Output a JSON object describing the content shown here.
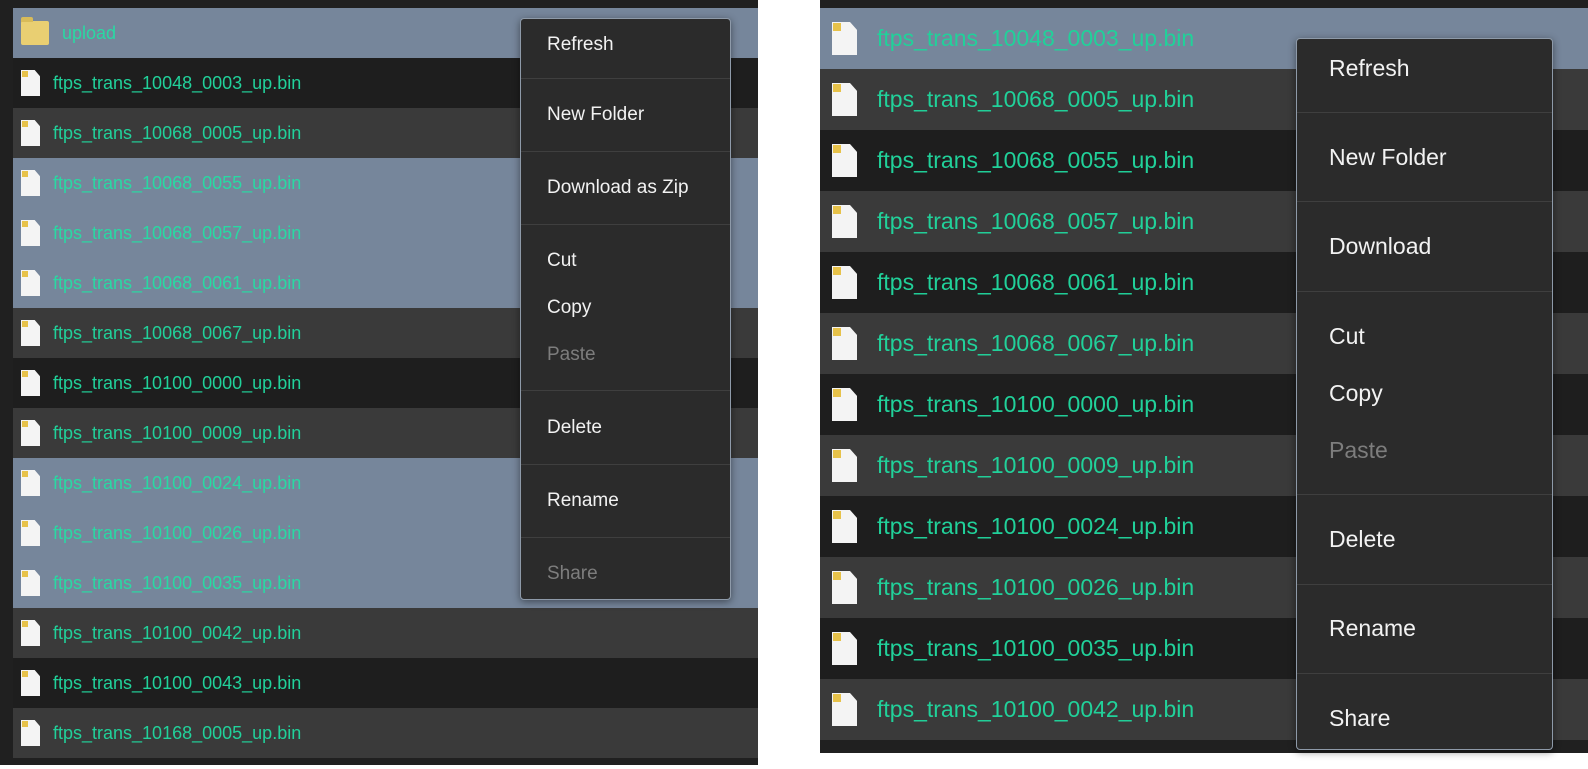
{
  "colors": {
    "file_name_text": "#21d19a",
    "selected_row": "#76869b",
    "row_dark": "#1e1e1e",
    "row_mid": "#3a3a3a",
    "menu_bg": "#2b2b2b",
    "menu_text": "#f2f2f2",
    "menu_disabled_text": "#7d7d7d"
  },
  "left_panel": {
    "rows": [
      {
        "name": "upload",
        "icon": "folder-icon",
        "state": "sel"
      },
      {
        "name": "ftps_trans_10048_0003_up.bin",
        "icon": "file-icon",
        "state": "dark"
      },
      {
        "name": "ftps_trans_10068_0005_up.bin",
        "icon": "file-icon",
        "state": "mid"
      },
      {
        "name": "ftps_trans_10068_0055_up.bin",
        "icon": "file-icon",
        "state": "sel"
      },
      {
        "name": "ftps_trans_10068_0057_up.bin",
        "icon": "file-icon",
        "state": "sel"
      },
      {
        "name": "ftps_trans_10068_0061_up.bin",
        "icon": "file-icon",
        "state": "sel"
      },
      {
        "name": "ftps_trans_10068_0067_up.bin",
        "icon": "file-icon",
        "state": "mid"
      },
      {
        "name": "ftps_trans_10100_0000_up.bin",
        "icon": "file-icon",
        "state": "dark"
      },
      {
        "name": "ftps_trans_10100_0009_up.bin",
        "icon": "file-icon",
        "state": "mid"
      },
      {
        "name": "ftps_trans_10100_0024_up.bin",
        "icon": "file-icon",
        "state": "sel"
      },
      {
        "name": "ftps_trans_10100_0026_up.bin",
        "icon": "file-icon",
        "state": "sel"
      },
      {
        "name": "ftps_trans_10100_0035_up.bin",
        "icon": "file-icon",
        "state": "sel"
      },
      {
        "name": "ftps_trans_10100_0042_up.bin",
        "icon": "file-icon",
        "state": "mid"
      },
      {
        "name": "ftps_trans_10100_0043_up.bin",
        "icon": "file-icon",
        "state": "dark"
      },
      {
        "name": "ftps_trans_10168_0005_up.bin",
        "icon": "file-icon",
        "state": "mid"
      }
    ],
    "menu": {
      "refresh": "Refresh",
      "new_folder": "New Folder",
      "download_zip": "Download as Zip",
      "cut": "Cut",
      "copy": "Copy",
      "paste": "Paste",
      "delete": "Delete",
      "rename": "Rename",
      "share": "Share"
    }
  },
  "right_panel": {
    "rows": [
      {
        "name": "ftps_trans_10048_0003_up.bin",
        "icon": "file-icon",
        "state": "sel"
      },
      {
        "name": "ftps_trans_10068_0005_up.bin",
        "icon": "file-icon",
        "state": "mid"
      },
      {
        "name": "ftps_trans_10068_0055_up.bin",
        "icon": "file-icon",
        "state": "dark"
      },
      {
        "name": "ftps_trans_10068_0057_up.bin",
        "icon": "file-icon",
        "state": "mid"
      },
      {
        "name": "ftps_trans_10068_0061_up.bin",
        "icon": "file-icon",
        "state": "dark"
      },
      {
        "name": "ftps_trans_10068_0067_up.bin",
        "icon": "file-icon",
        "state": "mid"
      },
      {
        "name": "ftps_trans_10100_0000_up.bin",
        "icon": "file-icon",
        "state": "dark"
      },
      {
        "name": "ftps_trans_10100_0009_up.bin",
        "icon": "file-icon",
        "state": "mid"
      },
      {
        "name": "ftps_trans_10100_0024_up.bin",
        "icon": "file-icon",
        "state": "dark"
      },
      {
        "name": "ftps_trans_10100_0026_up.bin",
        "icon": "file-icon",
        "state": "mid"
      },
      {
        "name": "ftps_trans_10100_0035_up.bin",
        "icon": "file-icon",
        "state": "dark"
      },
      {
        "name": "ftps_trans_10100_0042_up.bin",
        "icon": "file-icon",
        "state": "mid"
      }
    ],
    "menu": {
      "refresh": "Refresh",
      "new_folder": "New Folder",
      "download": "Download",
      "cut": "Cut",
      "copy": "Copy",
      "paste": "Paste",
      "delete": "Delete",
      "rename": "Rename",
      "share": "Share"
    }
  }
}
